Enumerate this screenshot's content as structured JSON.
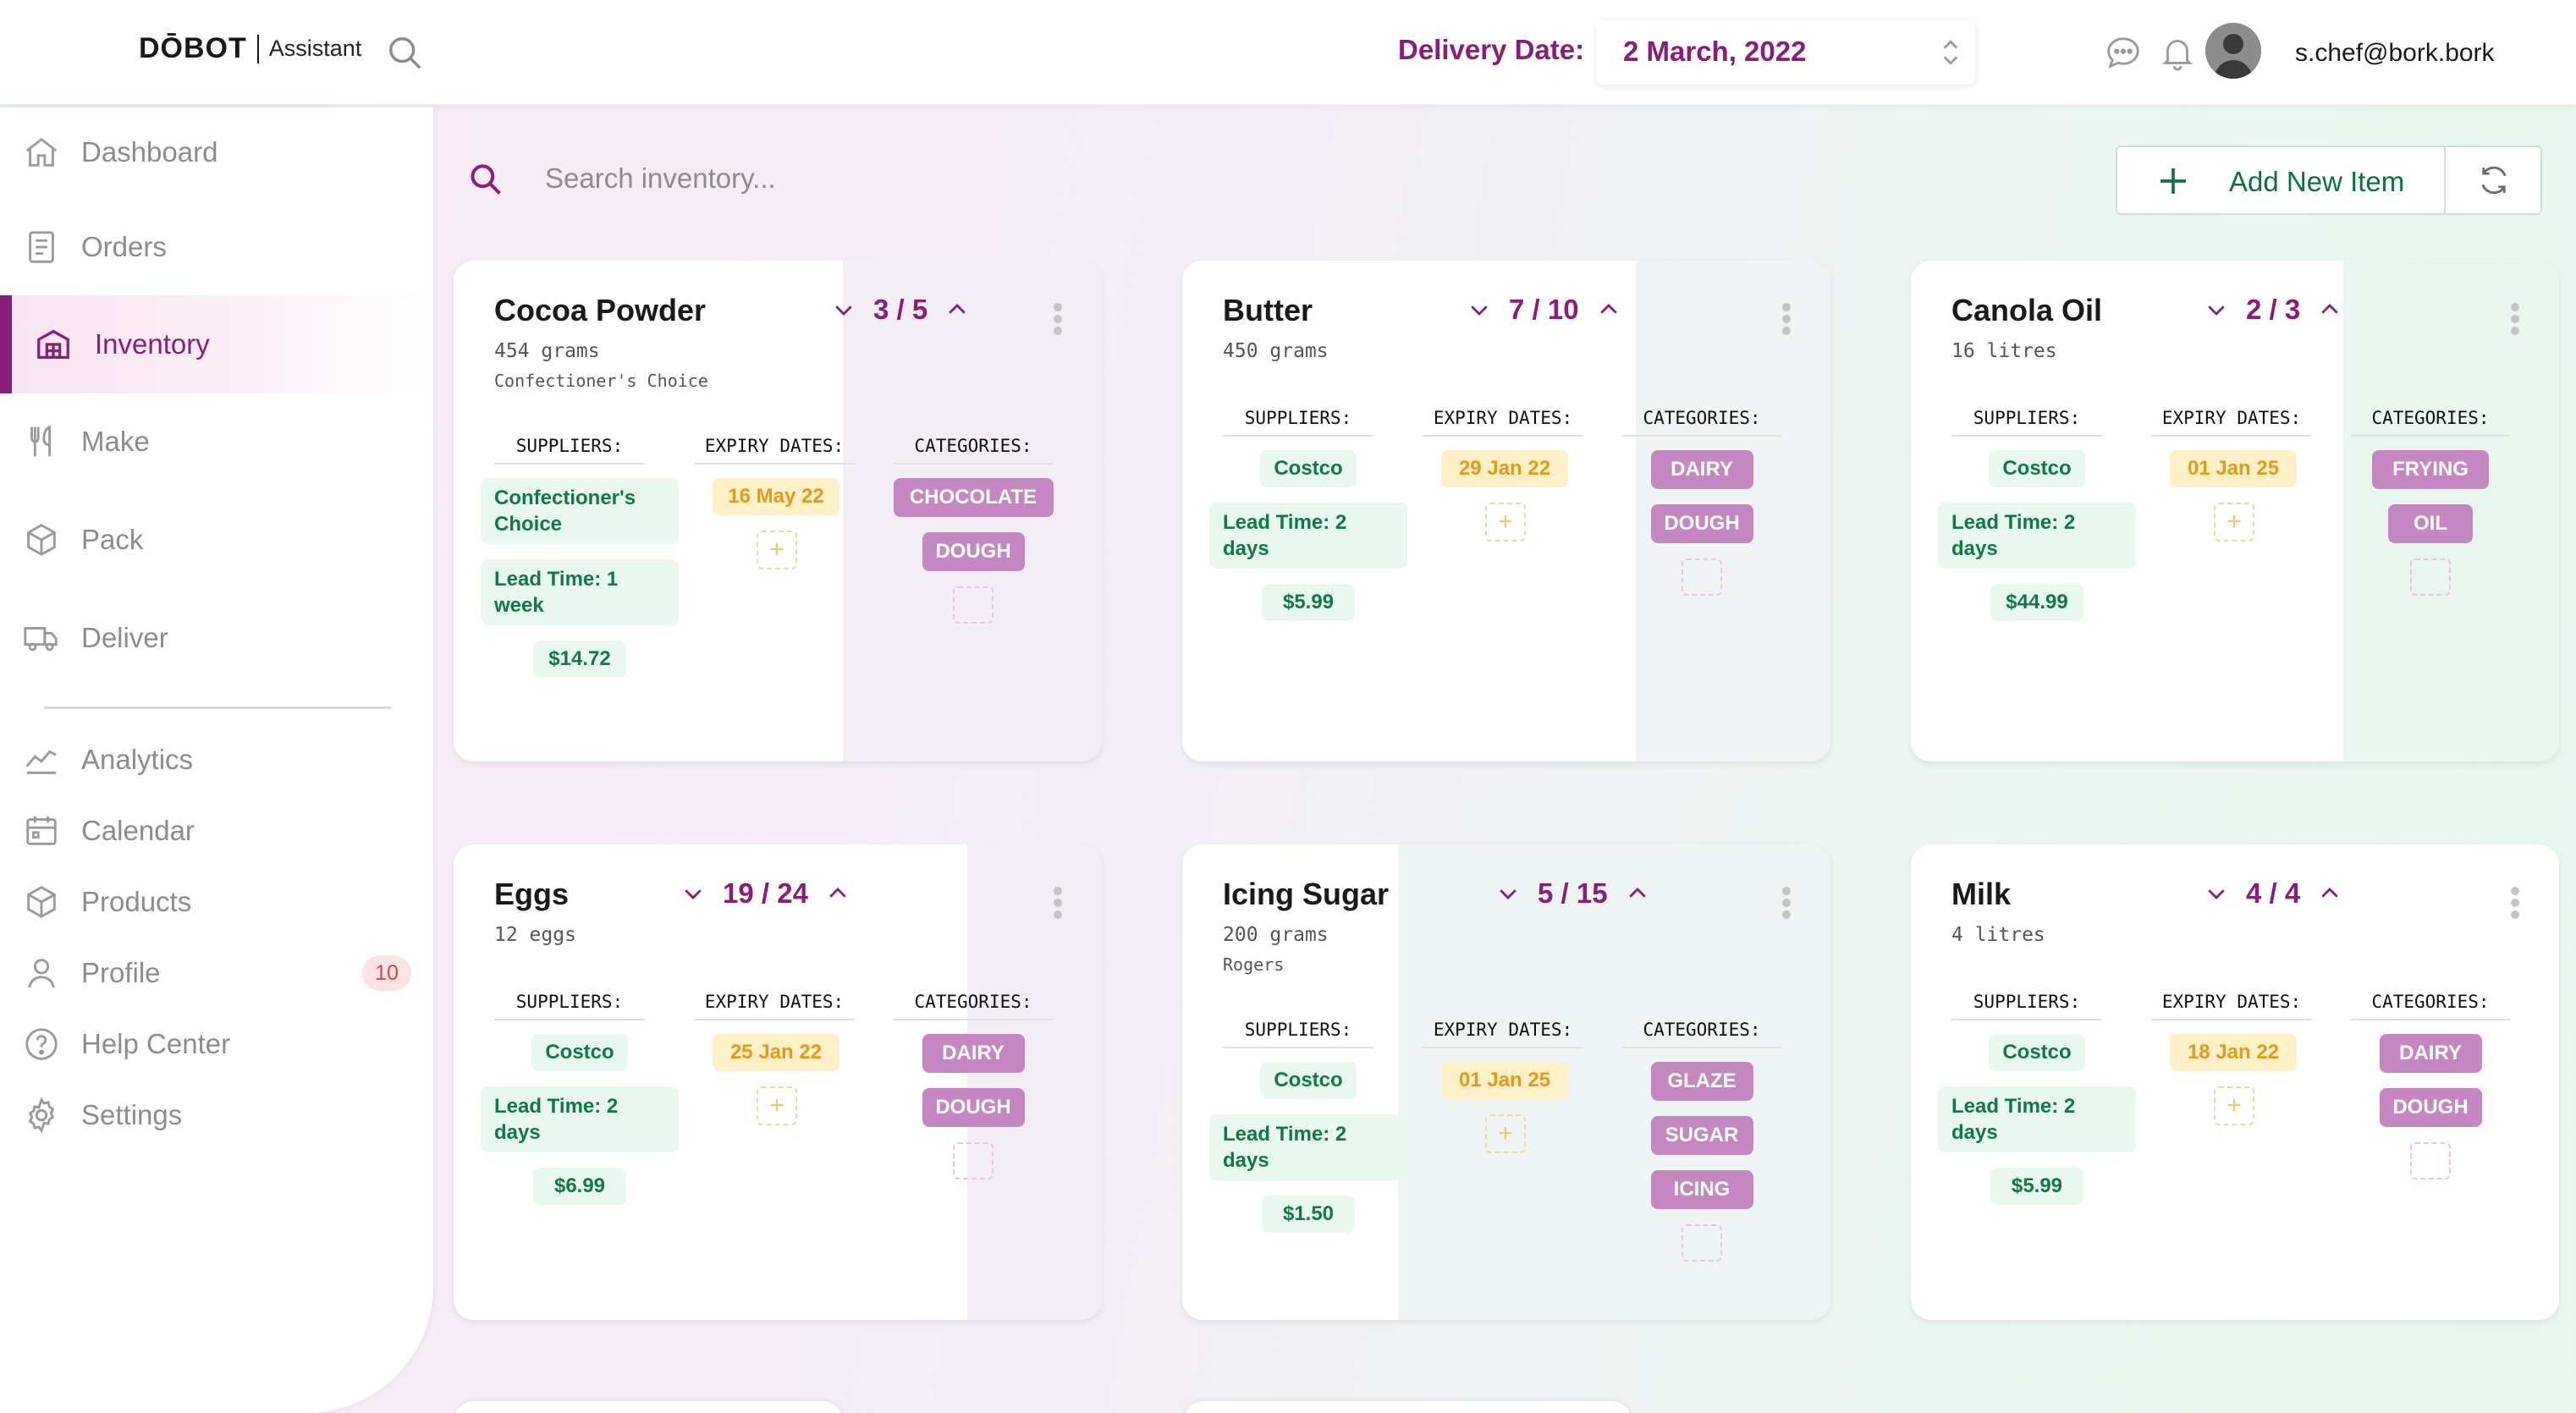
{
  "header": {
    "logo_main": "DŌBOT",
    "logo_sub": "Assistant",
    "delivery_label": "Delivery Date:",
    "delivery_date": "2 March, 2022",
    "user_email": "s.chef@bork.bork"
  },
  "sidebar": {
    "items": [
      {
        "label": "Dashboard",
        "icon": "home-icon"
      },
      {
        "label": "Orders",
        "icon": "document-icon"
      },
      {
        "label": "Inventory",
        "icon": "warehouse-icon",
        "active": true
      },
      {
        "label": "Make",
        "icon": "utensils-icon"
      },
      {
        "label": "Pack",
        "icon": "box-icon"
      },
      {
        "label": "Deliver",
        "icon": "truck-icon"
      },
      {
        "label": "Analytics",
        "icon": "chart-line-icon"
      },
      {
        "label": "Calendar",
        "icon": "calendar-icon"
      },
      {
        "label": "Products",
        "icon": "cube-icon"
      },
      {
        "label": "Profile",
        "icon": "user-icon",
        "badge": "10"
      },
      {
        "label": "Help Center",
        "icon": "help-icon"
      },
      {
        "label": "Settings",
        "icon": "gear-icon"
      }
    ]
  },
  "toolbar": {
    "search_placeholder": "Search inventory...",
    "add_label": "Add New Item"
  },
  "columns": {
    "suppliers": "SUPPLIERS:",
    "expiry": "EXPIRY DATES:",
    "categories": "CATEGORIES:"
  },
  "colors": {
    "accent": "#8a1c7c",
    "supplier_green": "#0f7a46",
    "expiry_yellow": "#e29a1d",
    "category_purple": "#c487c2"
  },
  "cards": [
    {
      "name": "Cocoa Powder",
      "quantity": "454 grams",
      "brand": "Confectioner's Choice",
      "count": "3 / 5",
      "stock_fraction": 0.6,
      "supplier": "Confectioner's Choice",
      "lead_time": "Lead Time: 1 week",
      "price": "$14.72",
      "expiry": [
        "16 May 22"
      ],
      "categories": [
        "CHOCOLATE",
        "DOUGH"
      ]
    },
    {
      "name": "Butter",
      "quantity": "450 grams",
      "brand": "",
      "count": "7 / 10",
      "stock_fraction": 0.7,
      "supplier": "Costco",
      "lead_time": "Lead Time: 2 days",
      "price": "$5.99",
      "expiry": [
        "29 Jan 22"
      ],
      "categories": [
        "DAIRY",
        "DOUGH"
      ]
    },
    {
      "name": "Canola Oil",
      "quantity": "16 litres",
      "brand": "",
      "count": "2 / 3",
      "stock_fraction": 0.667,
      "supplier": "Costco",
      "lead_time": "Lead Time: 2 days",
      "price": "$44.99",
      "expiry": [
        "01 Jan 25"
      ],
      "categories": [
        "FRYING",
        "OIL"
      ]
    },
    {
      "name": "Eggs",
      "quantity": "12 eggs",
      "brand": "",
      "count": "19 / 24",
      "stock_fraction": 0.792,
      "supplier": "Costco",
      "lead_time": "Lead Time: 2 days",
      "price": "$6.99",
      "expiry": [
        "25 Jan 22"
      ],
      "categories": [
        "DAIRY",
        "DOUGH"
      ]
    },
    {
      "name": "Icing Sugar",
      "quantity": "200 grams",
      "brand": "Rogers",
      "count": "5 / 15",
      "stock_fraction": 0.333,
      "supplier": "Costco",
      "lead_time": "Lead Time: 2 days",
      "price": "$1.50",
      "expiry": [
        "01 Jan 25"
      ],
      "categories": [
        "GLAZE",
        "SUGAR",
        "ICING"
      ]
    },
    {
      "name": "Milk",
      "quantity": "4 litres",
      "brand": "",
      "count": "4 / 4",
      "stock_fraction": 1.0,
      "supplier": "Costco",
      "lead_time": "Lead Time: 2 days",
      "price": "$5.99",
      "expiry": [
        "18 Jan 22"
      ],
      "categories": [
        "DAIRY",
        "DOUGH"
      ]
    }
  ]
}
